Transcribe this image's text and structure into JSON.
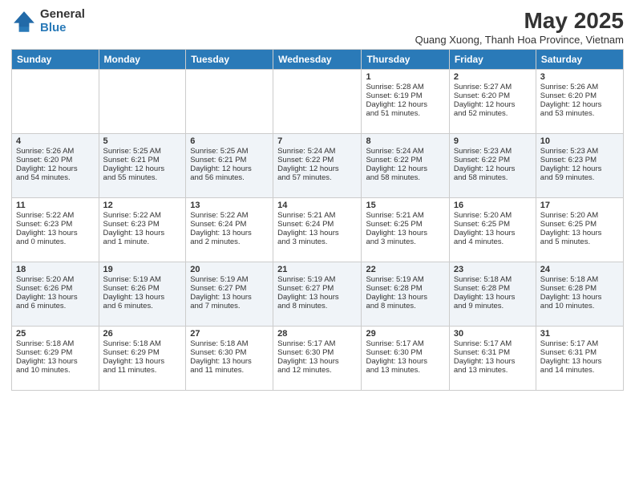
{
  "logo": {
    "general": "General",
    "blue": "Blue"
  },
  "title": "May 2025",
  "subtitle": "Quang Xuong, Thanh Hoa Province, Vietnam",
  "headers": [
    "Sunday",
    "Monday",
    "Tuesday",
    "Wednesday",
    "Thursday",
    "Friday",
    "Saturday"
  ],
  "weeks": [
    [
      {
        "day": "",
        "info": ""
      },
      {
        "day": "",
        "info": ""
      },
      {
        "day": "",
        "info": ""
      },
      {
        "day": "",
        "info": ""
      },
      {
        "day": "1",
        "info": "Sunrise: 5:28 AM\nSunset: 6:19 PM\nDaylight: 12 hours\nand 51 minutes."
      },
      {
        "day": "2",
        "info": "Sunrise: 5:27 AM\nSunset: 6:20 PM\nDaylight: 12 hours\nand 52 minutes."
      },
      {
        "day": "3",
        "info": "Sunrise: 5:26 AM\nSunset: 6:20 PM\nDaylight: 12 hours\nand 53 minutes."
      }
    ],
    [
      {
        "day": "4",
        "info": "Sunrise: 5:26 AM\nSunset: 6:20 PM\nDaylight: 12 hours\nand 54 minutes."
      },
      {
        "day": "5",
        "info": "Sunrise: 5:25 AM\nSunset: 6:21 PM\nDaylight: 12 hours\nand 55 minutes."
      },
      {
        "day": "6",
        "info": "Sunrise: 5:25 AM\nSunset: 6:21 PM\nDaylight: 12 hours\nand 56 minutes."
      },
      {
        "day": "7",
        "info": "Sunrise: 5:24 AM\nSunset: 6:22 PM\nDaylight: 12 hours\nand 57 minutes."
      },
      {
        "day": "8",
        "info": "Sunrise: 5:24 AM\nSunset: 6:22 PM\nDaylight: 12 hours\nand 58 minutes."
      },
      {
        "day": "9",
        "info": "Sunrise: 5:23 AM\nSunset: 6:22 PM\nDaylight: 12 hours\nand 58 minutes."
      },
      {
        "day": "10",
        "info": "Sunrise: 5:23 AM\nSunset: 6:23 PM\nDaylight: 12 hours\nand 59 minutes."
      }
    ],
    [
      {
        "day": "11",
        "info": "Sunrise: 5:22 AM\nSunset: 6:23 PM\nDaylight: 13 hours\nand 0 minutes."
      },
      {
        "day": "12",
        "info": "Sunrise: 5:22 AM\nSunset: 6:23 PM\nDaylight: 13 hours\nand 1 minute."
      },
      {
        "day": "13",
        "info": "Sunrise: 5:22 AM\nSunset: 6:24 PM\nDaylight: 13 hours\nand 2 minutes."
      },
      {
        "day": "14",
        "info": "Sunrise: 5:21 AM\nSunset: 6:24 PM\nDaylight: 13 hours\nand 3 minutes."
      },
      {
        "day": "15",
        "info": "Sunrise: 5:21 AM\nSunset: 6:25 PM\nDaylight: 13 hours\nand 3 minutes."
      },
      {
        "day": "16",
        "info": "Sunrise: 5:20 AM\nSunset: 6:25 PM\nDaylight: 13 hours\nand 4 minutes."
      },
      {
        "day": "17",
        "info": "Sunrise: 5:20 AM\nSunset: 6:25 PM\nDaylight: 13 hours\nand 5 minutes."
      }
    ],
    [
      {
        "day": "18",
        "info": "Sunrise: 5:20 AM\nSunset: 6:26 PM\nDaylight: 13 hours\nand 6 minutes."
      },
      {
        "day": "19",
        "info": "Sunrise: 5:19 AM\nSunset: 6:26 PM\nDaylight: 13 hours\nand 6 minutes."
      },
      {
        "day": "20",
        "info": "Sunrise: 5:19 AM\nSunset: 6:27 PM\nDaylight: 13 hours\nand 7 minutes."
      },
      {
        "day": "21",
        "info": "Sunrise: 5:19 AM\nSunset: 6:27 PM\nDaylight: 13 hours\nand 8 minutes."
      },
      {
        "day": "22",
        "info": "Sunrise: 5:19 AM\nSunset: 6:28 PM\nDaylight: 13 hours\nand 8 minutes."
      },
      {
        "day": "23",
        "info": "Sunrise: 5:18 AM\nSunset: 6:28 PM\nDaylight: 13 hours\nand 9 minutes."
      },
      {
        "day": "24",
        "info": "Sunrise: 5:18 AM\nSunset: 6:28 PM\nDaylight: 13 hours\nand 10 minutes."
      }
    ],
    [
      {
        "day": "25",
        "info": "Sunrise: 5:18 AM\nSunset: 6:29 PM\nDaylight: 13 hours\nand 10 minutes."
      },
      {
        "day": "26",
        "info": "Sunrise: 5:18 AM\nSunset: 6:29 PM\nDaylight: 13 hours\nand 11 minutes."
      },
      {
        "day": "27",
        "info": "Sunrise: 5:18 AM\nSunset: 6:30 PM\nDaylight: 13 hours\nand 11 minutes."
      },
      {
        "day": "28",
        "info": "Sunrise: 5:17 AM\nSunset: 6:30 PM\nDaylight: 13 hours\nand 12 minutes."
      },
      {
        "day": "29",
        "info": "Sunrise: 5:17 AM\nSunset: 6:30 PM\nDaylight: 13 hours\nand 13 minutes."
      },
      {
        "day": "30",
        "info": "Sunrise: 5:17 AM\nSunset: 6:31 PM\nDaylight: 13 hours\nand 13 minutes."
      },
      {
        "day": "31",
        "info": "Sunrise: 5:17 AM\nSunset: 6:31 PM\nDaylight: 13 hours\nand 14 minutes."
      }
    ]
  ]
}
